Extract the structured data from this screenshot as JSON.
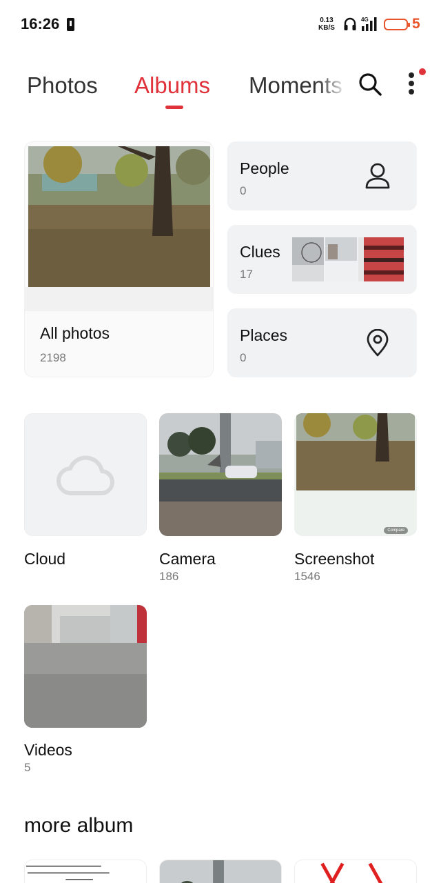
{
  "status": {
    "time": "16:26",
    "speed_value": "0.13",
    "speed_unit": "KB/S",
    "network": "4G",
    "battery_level": "5",
    "battery_color": "#e8532a"
  },
  "tabs": [
    {
      "label": "Photos",
      "active": false
    },
    {
      "label": "Albums",
      "active": true
    },
    {
      "label": "Moments",
      "active": false
    }
  ],
  "accent_color": "#e0323a",
  "icons": {
    "search": "search-icon",
    "more": "more-vertical-icon",
    "people": "person-icon",
    "places": "location-pin-icon",
    "cloud": "cloud-icon"
  },
  "all_photos": {
    "title": "All photos",
    "count": "2198"
  },
  "people": {
    "title": "People",
    "count": "0"
  },
  "clues": {
    "title": "Clues",
    "count": "17"
  },
  "places": {
    "title": "Places",
    "count": "0"
  },
  "albums": [
    {
      "name": "Cloud",
      "count": ""
    },
    {
      "name": "Camera",
      "count": "186"
    },
    {
      "name": "Screenshot",
      "count": "1546"
    },
    {
      "name": "Videos",
      "count": "5"
    }
  ],
  "screenshot_badge": "Compare",
  "more_album": {
    "title": "more album"
  }
}
